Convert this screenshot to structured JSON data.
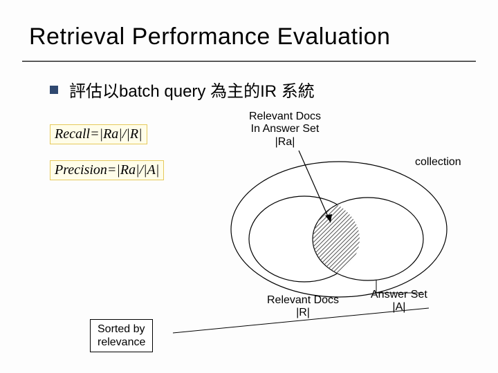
{
  "title": "Retrieval Performance Evaluation",
  "bullet": {
    "text": "評估以batch query 為主的IR 系統"
  },
  "formulas": {
    "recall": "Recall=|Ra|/|R|",
    "precision": "Precision=|Ra|/|A|"
  },
  "diagram": {
    "ra_label_l1": "Relevant Docs",
    "ra_label_l2": "In Answer Set",
    "ra_label_l3": "|Ra|",
    "collection_label": "collection",
    "r_label_l1": "Relevant Docs",
    "r_label_l2": "|R|",
    "a_label_l1": "Answer Set",
    "a_label_l2": "|A|"
  },
  "sorted_box": {
    "l1": "Sorted by",
    "l2": "relevance"
  }
}
